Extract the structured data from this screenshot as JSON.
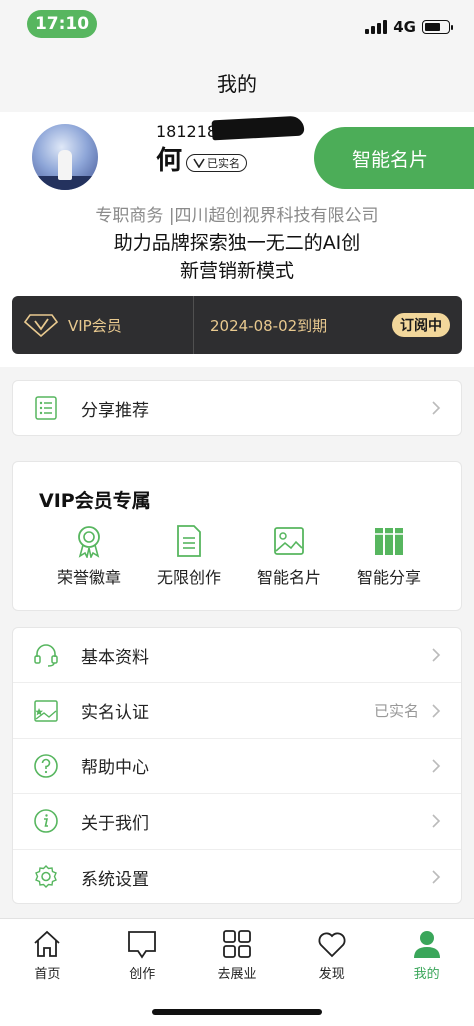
{
  "status_bar": {
    "time": "17:10",
    "network": "4G",
    "battery_level": 0.7
  },
  "nav": {
    "title": "我的"
  },
  "profile": {
    "phone": "181218",
    "name": "何",
    "verified_label": "已实名",
    "card_button": "智能名片",
    "company": "专职商务 |四川超创视界科技有限公司",
    "slogan_line1": "助力品牌探索独一无二的AI创",
    "slogan_line2": "新营销新模式"
  },
  "vip": {
    "label": "VIP会员",
    "expire": "2024-08-02到期",
    "subscribe": "订阅中",
    "accent": "#e8c98f"
  },
  "share": {
    "label": "分享推荐"
  },
  "vip_card": {
    "title": "VIP会员专属",
    "features": [
      {
        "label": "荣誉徽章",
        "icon": "medal-icon"
      },
      {
        "label": "无限创作",
        "icon": "document-icon"
      },
      {
        "label": "智能名片",
        "icon": "image-icon"
      },
      {
        "label": "智能分享",
        "icon": "books-icon"
      }
    ]
  },
  "menu": [
    {
      "label": "基本资料",
      "value": "",
      "icon": "headset-icon"
    },
    {
      "label": "实名认证",
      "value": "已实名",
      "icon": "id-image-icon"
    },
    {
      "label": "帮助中心",
      "value": "",
      "icon": "help-icon"
    },
    {
      "label": "关于我们",
      "value": "",
      "icon": "info-icon"
    },
    {
      "label": "系统设置",
      "value": "",
      "icon": "gear-icon"
    }
  ],
  "tabs": [
    {
      "label": "首页",
      "icon": "home-icon"
    },
    {
      "label": "创作",
      "icon": "create-icon"
    },
    {
      "label": "去展业",
      "icon": "grid-icon"
    },
    {
      "label": "发现",
      "icon": "heart-icon"
    },
    {
      "label": "我的",
      "icon": "user-icon",
      "active": true
    }
  ],
  "colors": {
    "primary_green": "#57b65f",
    "vip_dark": "#2e2e30",
    "subscribe_gold": "#f2d79b"
  }
}
